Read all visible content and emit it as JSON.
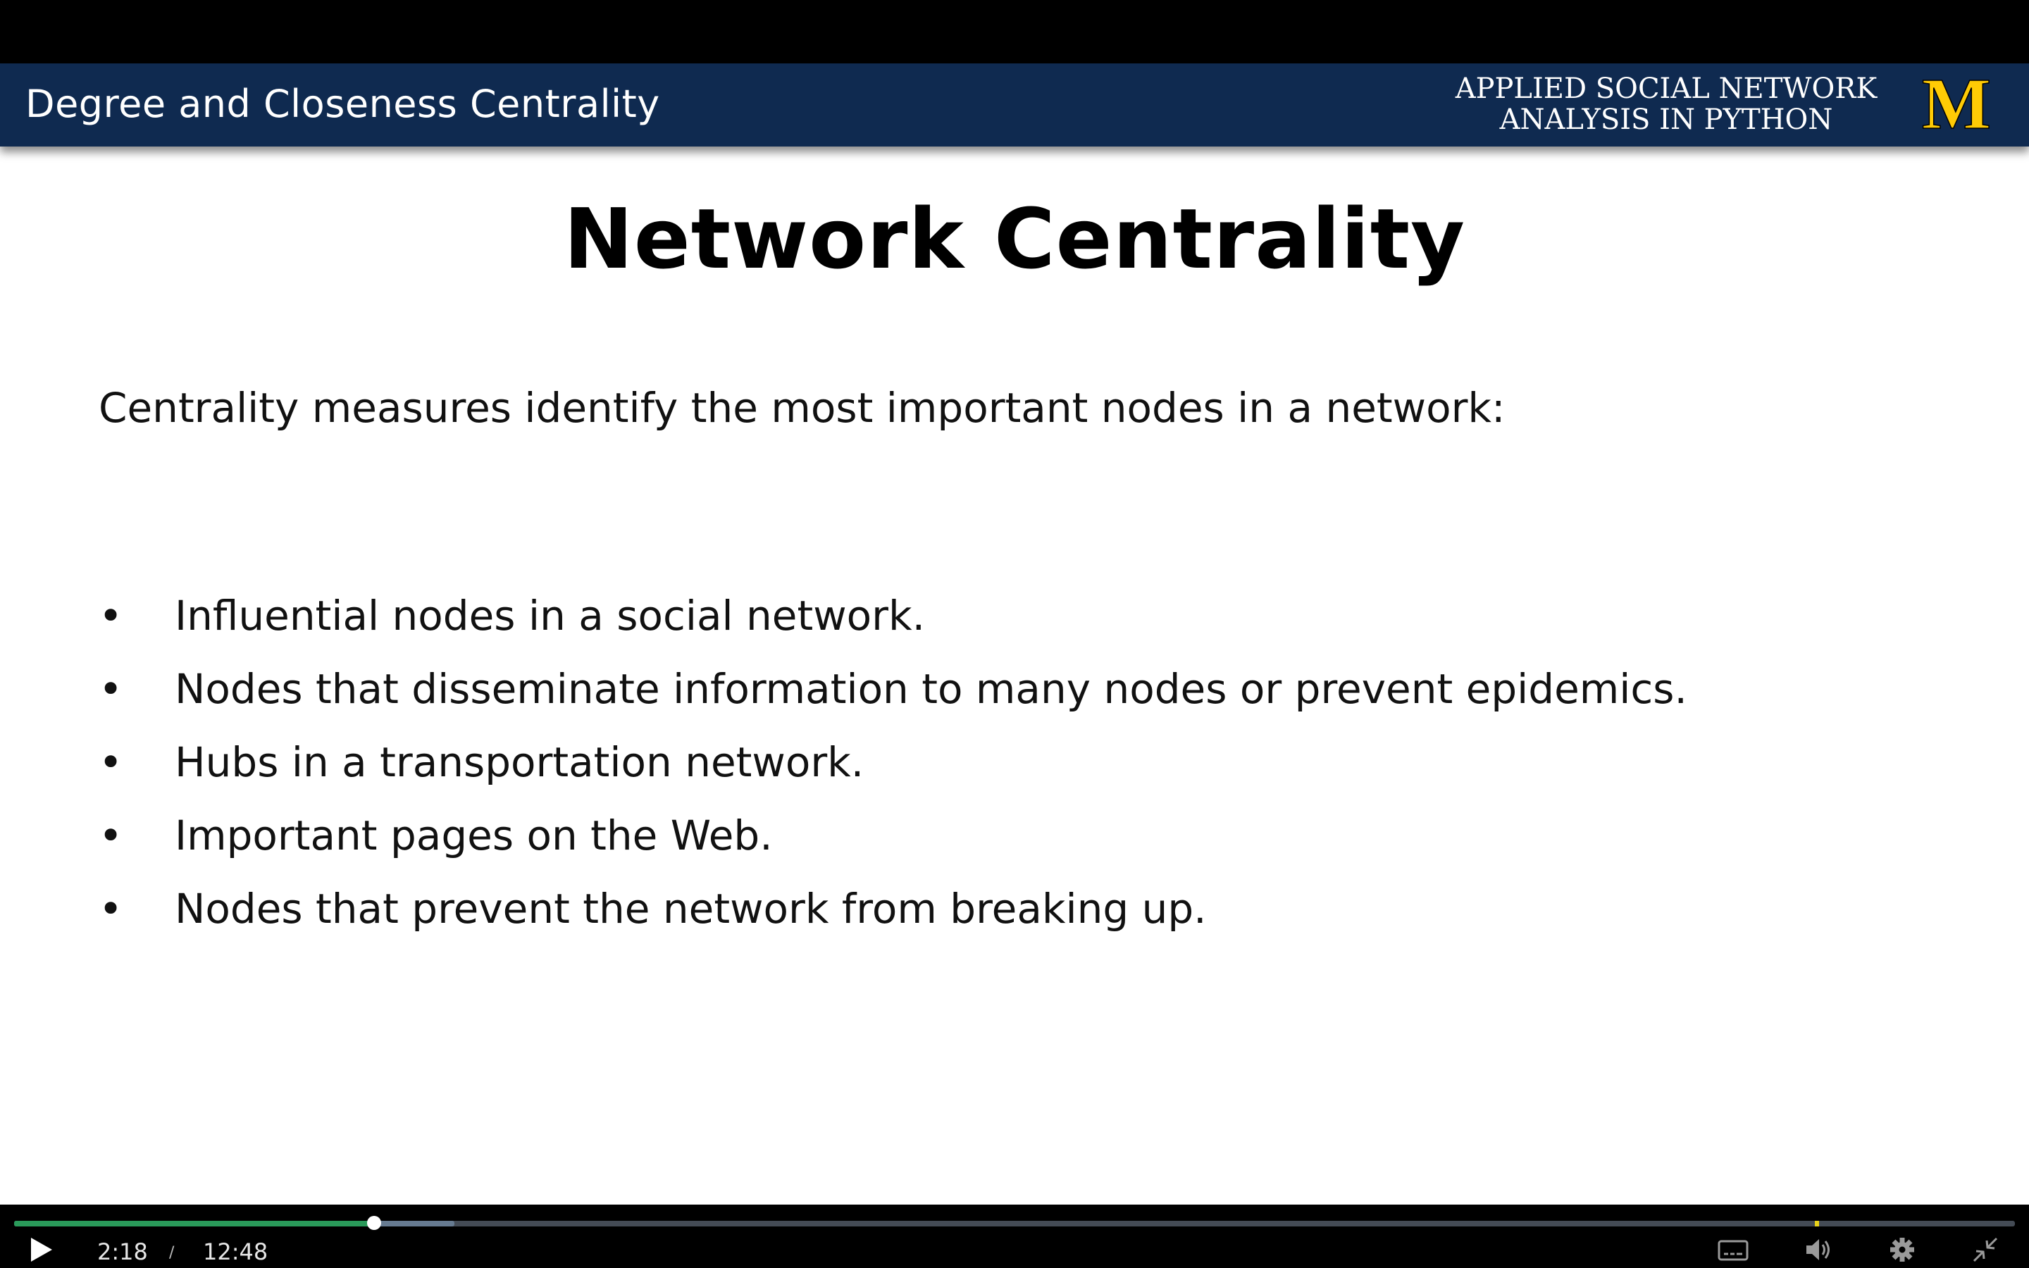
{
  "slide": {
    "header": {
      "section_title": "Degree and Closeness Centrality",
      "course_name": "APPLIED SOCIAL NETWORK\nANALYSIS IN PYTHON",
      "logo_letter": "M",
      "header_color": "#0f2a50",
      "logo_color": "#ffcb05"
    },
    "title": "Network Centrality",
    "intro": "Centrality measures identify the most important nodes in a network:",
    "bullet_symbol": "•",
    "bullets": [
      "Influential nodes in a social network.",
      "Nodes that disseminate information to many nodes or prevent epidemics.",
      "Hubs in a transportation network.",
      "Important pages on the Web.",
      "Nodes that prevent the network from breaking up."
    ]
  },
  "player": {
    "current_time": "2:18",
    "separator": "/",
    "duration": "12:48",
    "progress_fraction": 0.18,
    "buffered_fraction": 0.22,
    "played_color": "#2a9a5a",
    "icons": [
      "play-icon",
      "captions-icon",
      "volume-icon",
      "settings-icon",
      "exit-fullscreen-icon"
    ]
  }
}
